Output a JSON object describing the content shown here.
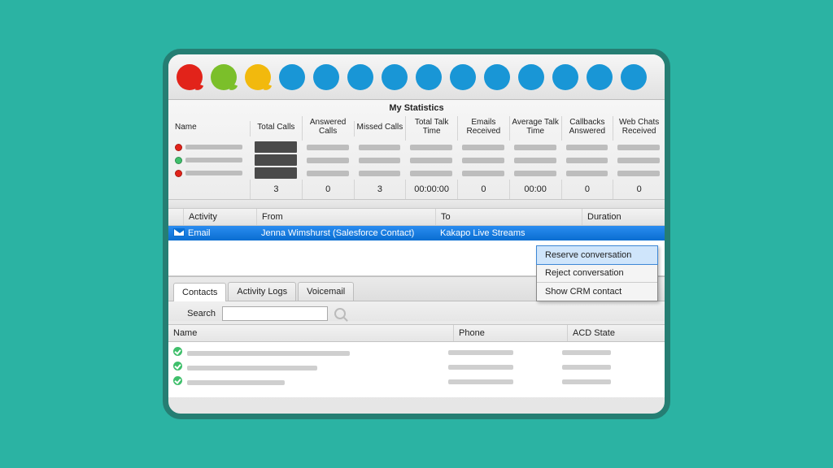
{
  "toolbar": {
    "dots": [
      {
        "color": "#e2231a",
        "tail": true
      },
      {
        "color": "#7bbf2a",
        "tail": true
      },
      {
        "color": "#f2b90d",
        "tail": true
      },
      {
        "color": "#1996d6"
      },
      {
        "color": "#1996d6"
      },
      {
        "color": "#1996d6"
      },
      {
        "color": "#1996d6"
      },
      {
        "color": "#1996d6"
      },
      {
        "color": "#1996d6"
      },
      {
        "color": "#1996d6"
      },
      {
        "color": "#1996d6"
      },
      {
        "color": "#1996d6"
      },
      {
        "color": "#1996d6"
      },
      {
        "color": "#1996d6"
      }
    ]
  },
  "stats": {
    "title": "My Statistics",
    "headers": [
      "Name",
      "Total Calls",
      "Answered Calls",
      "Missed Calls",
      "Total Talk Time",
      "Emails Received",
      "Average Talk Time",
      "Callbacks Answered",
      "Web Chats Received"
    ],
    "rows": [
      {
        "status": "#e2231a"
      },
      {
        "status": "#3fbf6b"
      },
      {
        "status": "#e2231a"
      }
    ],
    "totals": [
      "",
      "3",
      "0",
      "3",
      "00:00:00",
      "0",
      "00:00",
      "0",
      "0"
    ]
  },
  "activity": {
    "headers": [
      "",
      "Activity",
      "From",
      "To",
      "Duration"
    ],
    "selected": {
      "activity": "Email",
      "from": "Jenna Wimshurst (Salesforce Contact)",
      "to": "Kakapo Live Streams",
      "duration": ""
    }
  },
  "context_menu": {
    "items": [
      "Reserve conversation",
      "Reject conversation",
      "Show CRM contact"
    ],
    "highlighted": 0
  },
  "tabs": {
    "items": [
      "Contacts",
      "Activity Logs",
      "Voicemail"
    ],
    "active": 0
  },
  "search": {
    "label": "Search",
    "placeholder": ""
  },
  "contacts": {
    "headers": [
      "Name",
      "Phone",
      "ACD State"
    ],
    "rows": [
      {},
      {},
      {}
    ]
  }
}
